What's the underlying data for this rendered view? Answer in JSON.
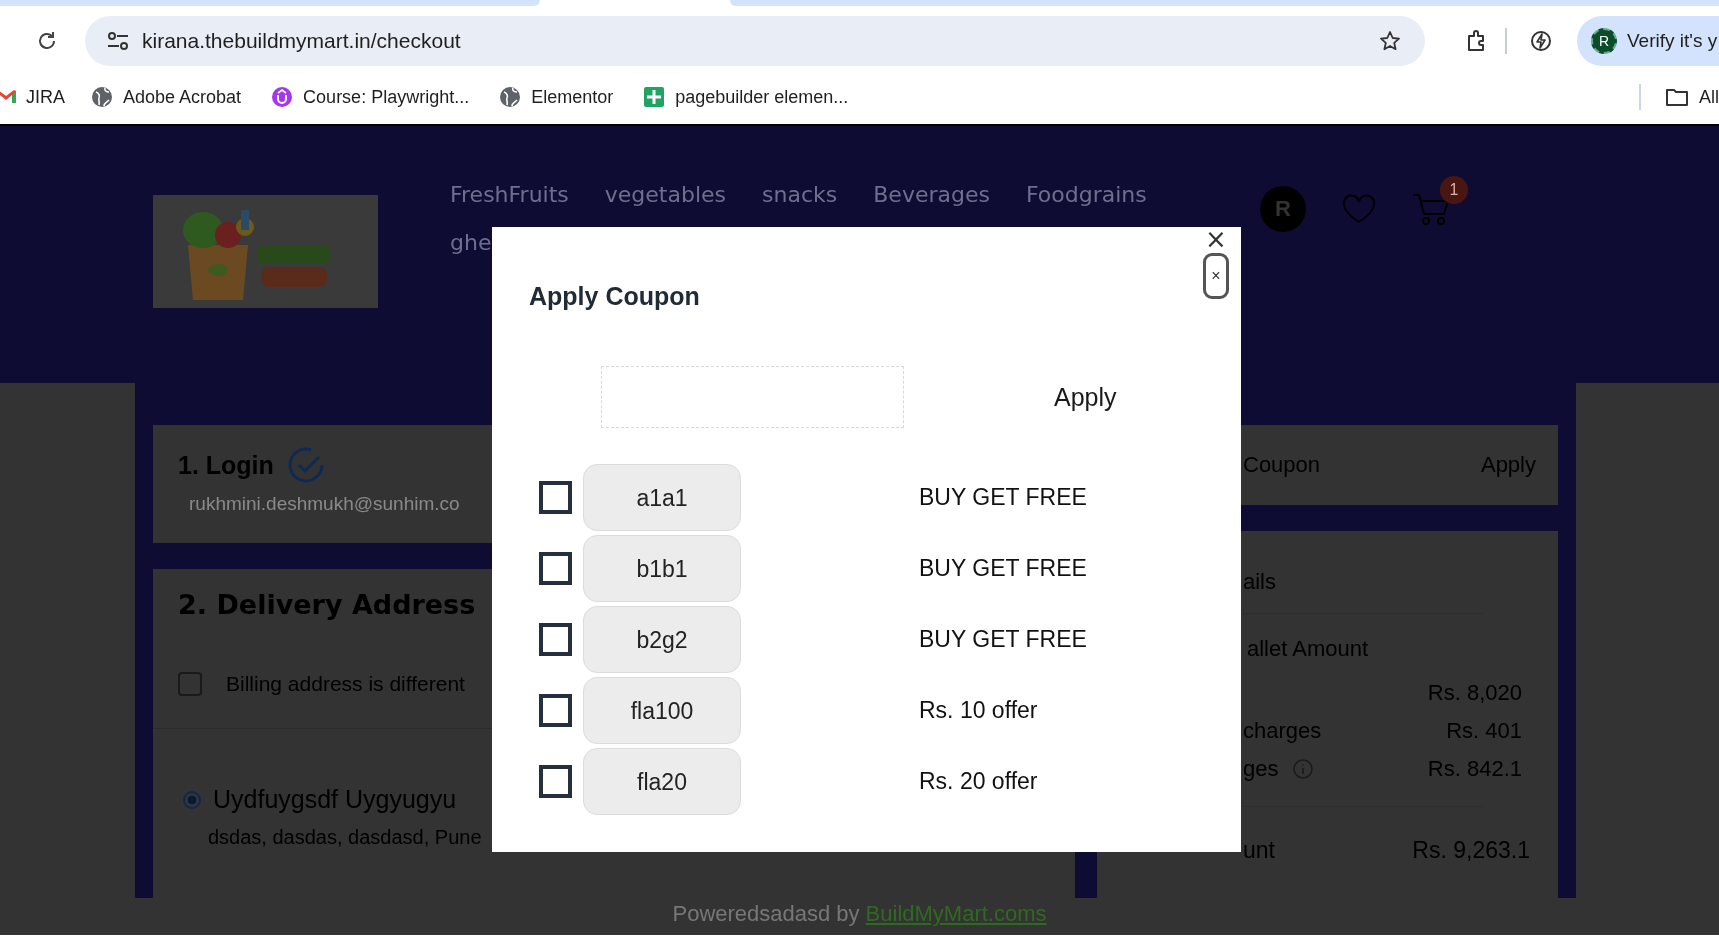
{
  "browser": {
    "address_bar": {
      "url": "kirana.thebuildmymart.in/checkout"
    },
    "profile": {
      "avatar": "R",
      "label": "Verify it's y"
    },
    "bookmarks": [
      {
        "label": "JIRA",
        "kind": "mail"
      },
      {
        "label": "Adobe Acrobat",
        "kind": "globe"
      },
      {
        "label": "Course: Playwright...",
        "kind": "course"
      },
      {
        "label": "Elementor",
        "kind": "globe"
      },
      {
        "label": "pagebuilder elemen...",
        "kind": "sheet"
      }
    ],
    "all_bookmarks": "All"
  },
  "site": {
    "nav": [
      "FreshFruits",
      "vegetables",
      "snacks",
      "Beverages",
      "Foodgrains",
      "ghe"
    ],
    "avatar": "R",
    "cart_count": "1"
  },
  "login": {
    "heading": "1. Login",
    "email": "rukhmini.deshmukh@sunhim.co"
  },
  "delivery": {
    "heading": "2. Delivery Address",
    "billing": {
      "label": "Billing address is different",
      "checked": false
    },
    "address": {
      "name": "Uydfuygsdf Uygyugyu",
      "selected": true,
      "line": "dsdas, dasdas, dasdasd, Pune"
    }
  },
  "coupon_bar": {
    "label": "Coupon",
    "action": "Apply"
  },
  "price_details": {
    "heading": "ails",
    "wallet": "allet Amount",
    "rows": [
      {
        "value": "Rs. 8,020"
      },
      {
        "label": "charges",
        "value": "Rs. 401"
      },
      {
        "label": "ges",
        "value": "Rs. 842.1",
        "info": true
      }
    ],
    "total": {
      "label": "unt",
      "value": "Rs. 9,263.1"
    }
  },
  "footer": {
    "text": "Poweredsadasd by",
    "link": "BuildMyMart.coms"
  },
  "modal": {
    "title": "Apply Coupon",
    "close": "×",
    "close_small": "×",
    "apply": "Apply",
    "coupons": [
      {
        "code": "a1a1",
        "description": "BUY GET FREE",
        "checked": false
      },
      {
        "code": "b1b1",
        "description": "BUY GET FREE",
        "checked": false
      },
      {
        "code": "b2g2",
        "description": "BUY GET FREE",
        "checked": false
      },
      {
        "code": "fla100",
        "description": "Rs. 10 offer",
        "checked": false
      },
      {
        "code": "fla20",
        "description": "Rs. 20 offer",
        "checked": false
      }
    ]
  }
}
